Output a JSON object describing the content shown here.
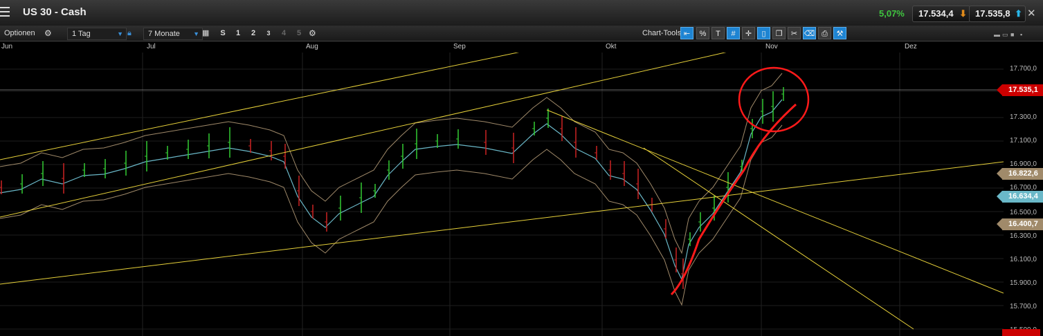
{
  "window": {
    "title": "US 30 - Cash",
    "change": "5,07%",
    "bid": "17.534,4",
    "ask": "17.535,8",
    "colors": {
      "positive": "#3fc63f",
      "bid_arrow": "#e08a1a",
      "ask_arrow": "#29b6e8"
    }
  },
  "toolbar": {
    "options_label": "Optionen",
    "interval_value": "1 Tag",
    "range_value": "7 Monate",
    "chart_types": [
      "S",
      "1",
      "2",
      "3",
      "4",
      "5"
    ],
    "chart_tools_label": "Chart-Tools",
    "tool_icons": [
      "back-arrow-icon",
      "percent-icon",
      "text-icon",
      "grid-icon",
      "crosshair-icon",
      "candle-icon",
      "window-icon",
      "scissors-icon",
      "tag-icon",
      "print-icon",
      "settings-icon"
    ]
  },
  "chart": {
    "months": [
      "Jun",
      "Jul",
      "Aug",
      "Sep",
      "Okt",
      "Nov",
      "Dez"
    ],
    "y_ticks": [
      "17.700,0",
      "17.535,1",
      "17.300,0",
      "17.100,0",
      "16.900,0",
      "16.822,6",
      "16.700,0",
      "16.634,4",
      "16.500,0",
      "16.400,7",
      "16.300,0",
      "16.100,0",
      "15.900,0",
      "15.700,0",
      "15.500,0"
    ],
    "axis_labels": [
      "17.700,0",
      "17.300,0",
      "17.100,0",
      "16.900,0",
      "16.700,0",
      "16.500,0",
      "16.300,0",
      "16.100,0",
      "15.900,0",
      "15.700,0",
      "15.500,0"
    ],
    "price_labels": {
      "last": "17.535,1",
      "upper_band": "16.822,6",
      "ma": "16.634,4",
      "lower_band": "16.400,7"
    },
    "colors": {
      "up": "#33cc33",
      "down": "#cc2222",
      "trendline": "#e8d23a",
      "ma": "#6ab8c8",
      "band": "#a08a6a",
      "annotation": "#ff1a1a"
    }
  }
}
